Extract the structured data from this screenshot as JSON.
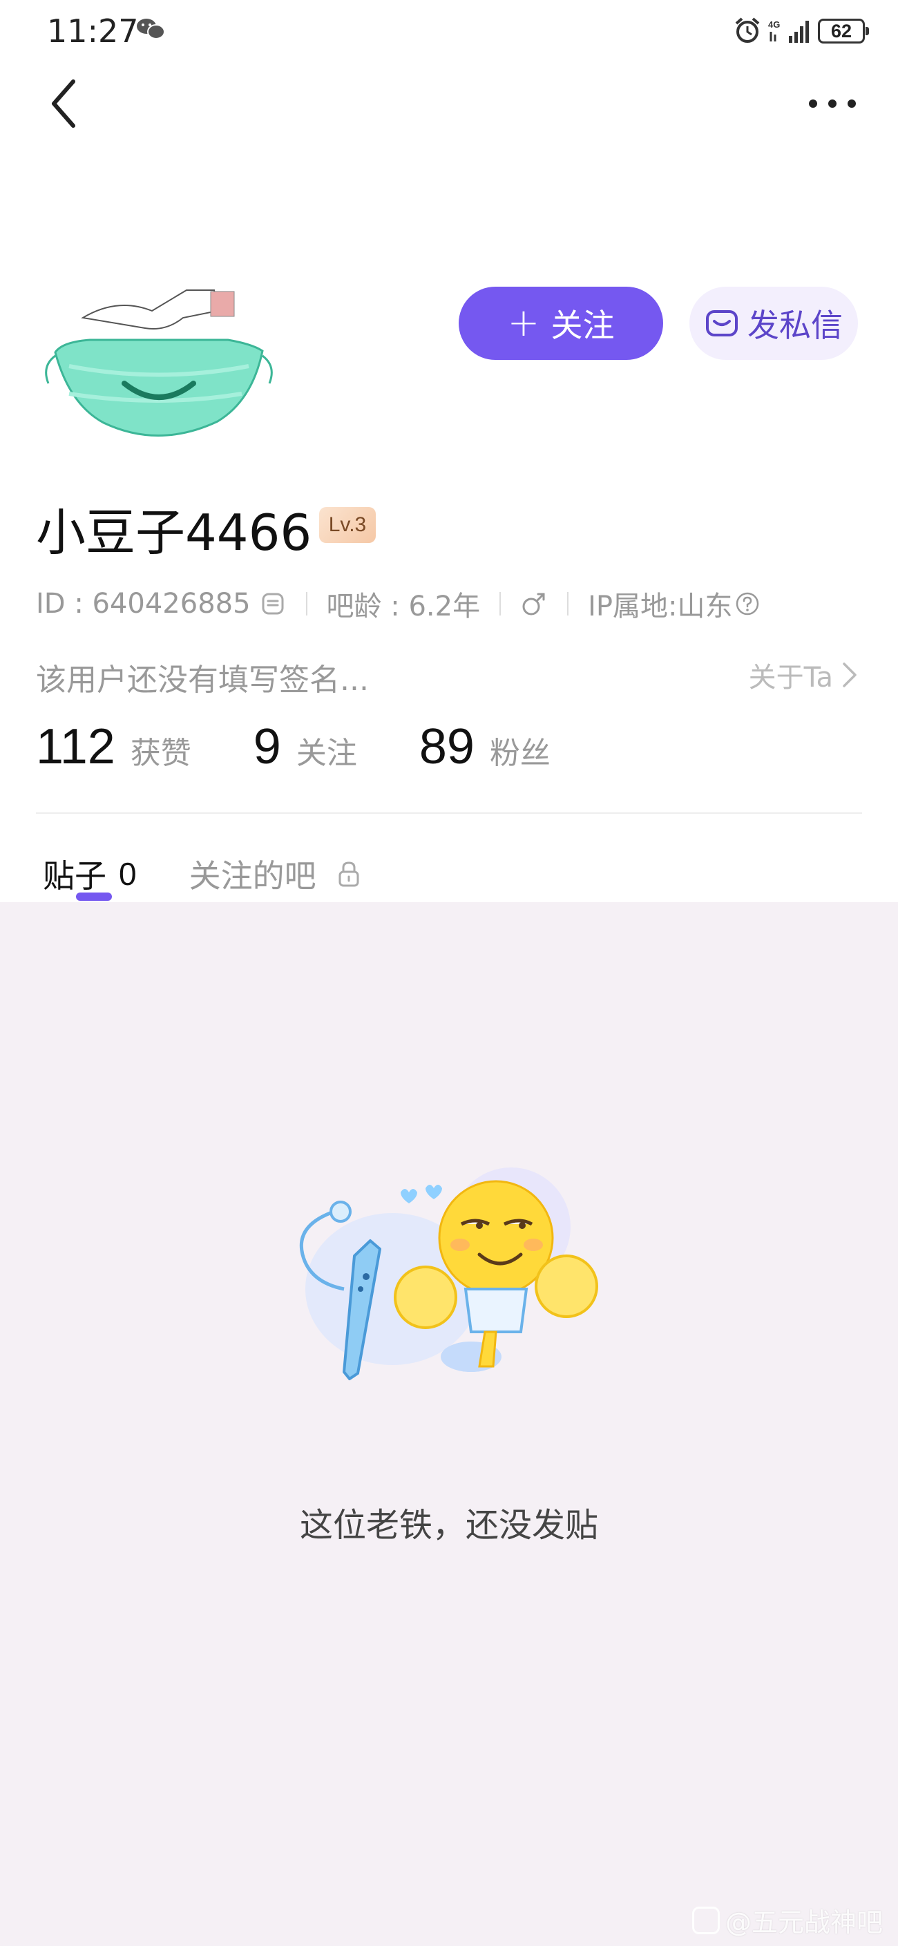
{
  "status_bar": {
    "time": "11:27",
    "network": "4G",
    "battery": "62"
  },
  "profile": {
    "follow_label": "关注",
    "message_label": "发私信",
    "username": "小豆子4466",
    "level": "Lv.3",
    "id_text": "ID : 640426885",
    "bar_age": "吧龄 : 6.2年",
    "gender": "male",
    "ip_location": "IP属地:山东",
    "signature": "该用户还没有填写签名...",
    "about_label": "关于Ta"
  },
  "stats": [
    {
      "value": "112",
      "label": "获赞"
    },
    {
      "value": "9",
      "label": "关注"
    },
    {
      "value": "89",
      "label": "粉丝"
    }
  ],
  "tabs": [
    {
      "label": "贴子",
      "count": "0",
      "active": true
    },
    {
      "label": "关注的吧",
      "locked": true
    }
  ],
  "empty_state": {
    "message": "这位老铁，还没发贴"
  },
  "watermark": "@五元战神吧",
  "colors": {
    "accent": "#7558f0",
    "background": "#f5f0f5"
  }
}
